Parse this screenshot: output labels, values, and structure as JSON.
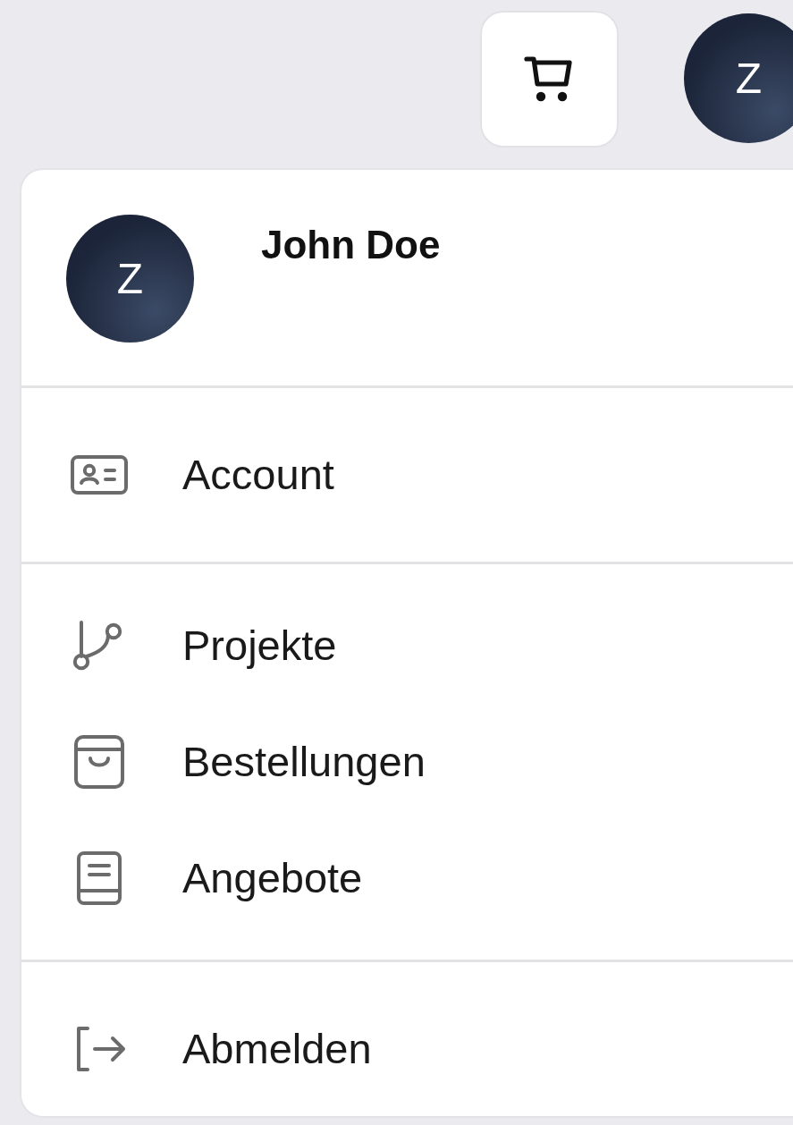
{
  "topbar": {
    "avatar_letter": "Z"
  },
  "user": {
    "avatar_letter": "Z",
    "name": "John Doe"
  },
  "sections": [
    [
      {
        "label": "Account"
      }
    ],
    [
      {
        "label": "Projekte"
      },
      {
        "label": "Bestellungen"
      },
      {
        "label": "Angebote"
      }
    ],
    [
      {
        "label": "Abmelden"
      }
    ]
  ]
}
